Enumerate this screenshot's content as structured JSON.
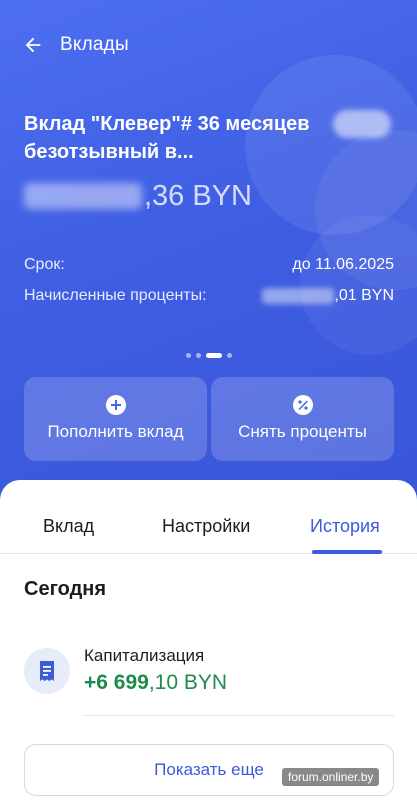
{
  "header": {
    "title": "Вклады"
  },
  "deposit": {
    "title": "Вклад \"Клевер\"# 36 месяцев  безотзывный в...",
    "balance_cents": ",36 BYN",
    "term_label": "Срок:",
    "term_value": "до 11.06.2025",
    "interest_label": "Начисленные проценты:",
    "interest_value_tail": ",01 BYN"
  },
  "pager": {
    "total": 4,
    "active_index": 2
  },
  "actions": {
    "deposit_label": "Пополнить вклад",
    "withdraw_label": "Снять проценты"
  },
  "tabs": [
    {
      "label": "Вклад",
      "active": false
    },
    {
      "label": "Настройки",
      "active": false
    },
    {
      "label": "История",
      "active": true
    }
  ],
  "history": {
    "section_title": "Сегодня",
    "items": [
      {
        "name": "Капитализация",
        "amount_main": "+6 699",
        "amount_tail": ",10 BYN",
        "icon": "receipt-icon"
      }
    ],
    "show_more_label": "Показать еще"
  },
  "watermark": "forum.onliner.by",
  "colors": {
    "accent": "#3b5bdb",
    "hero_bg": "#4466ec",
    "positive": "#1e8a4c"
  }
}
